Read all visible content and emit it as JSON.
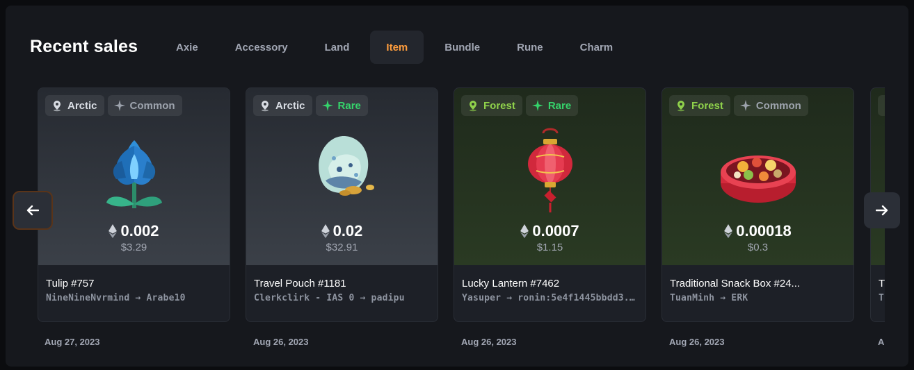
{
  "header": {
    "title": "Recent sales"
  },
  "tabs": [
    {
      "label": "Axie",
      "active": false
    },
    {
      "label": "Accessory",
      "active": false
    },
    {
      "label": "Land",
      "active": false
    },
    {
      "label": "Item",
      "active": true
    },
    {
      "label": "Bundle",
      "active": false
    },
    {
      "label": "Rune",
      "active": false
    },
    {
      "label": "Charm",
      "active": false
    }
  ],
  "cards": [
    {
      "land": "Arctic",
      "rarity": "Common",
      "art": "tulip",
      "price": "0.002",
      "usd": "$3.29",
      "name": "Tulip #757",
      "parties": "NineNineNvrmind → Arabe10",
      "date": "Aug 27, 2023"
    },
    {
      "land": "Arctic",
      "rarity": "Rare",
      "art": "travel-pouch",
      "price": "0.02",
      "usd": "$32.91",
      "name": "Travel Pouch #1181",
      "parties": "Clerkclirk - IAS 0 → padipu",
      "date": "Aug 26, 2023"
    },
    {
      "land": "Forest",
      "rarity": "Rare",
      "art": "lucky-lantern",
      "price": "0.0007",
      "usd": "$1.15",
      "name": "Lucky Lantern #7462",
      "parties": "Yasuper → ronin:5e4f1445bbdd3...",
      "date": "Aug 26, 2023"
    },
    {
      "land": "Forest",
      "rarity": "Common",
      "art": "snack-box",
      "price": "0.00018",
      "usd": "$0.3",
      "name": "Traditional Snack Box #24...",
      "parties": "TuanMinh → ERK",
      "date": "Aug 26, 2023"
    },
    {
      "land": "",
      "rarity": "",
      "art": "",
      "price": "",
      "usd": "",
      "name": "T",
      "parties": "T",
      "date": "A"
    }
  ],
  "colors": {
    "accent": "#ff9d3d",
    "rare": "#35d36b",
    "forest": "#8fd14b",
    "common": "#9da3ad"
  },
  "icons": {
    "prev": "arrow-left-icon",
    "next": "arrow-right-icon",
    "currency": "eth-icon",
    "land": "map-pin-icon",
    "rarity": "sparkle-icon"
  }
}
